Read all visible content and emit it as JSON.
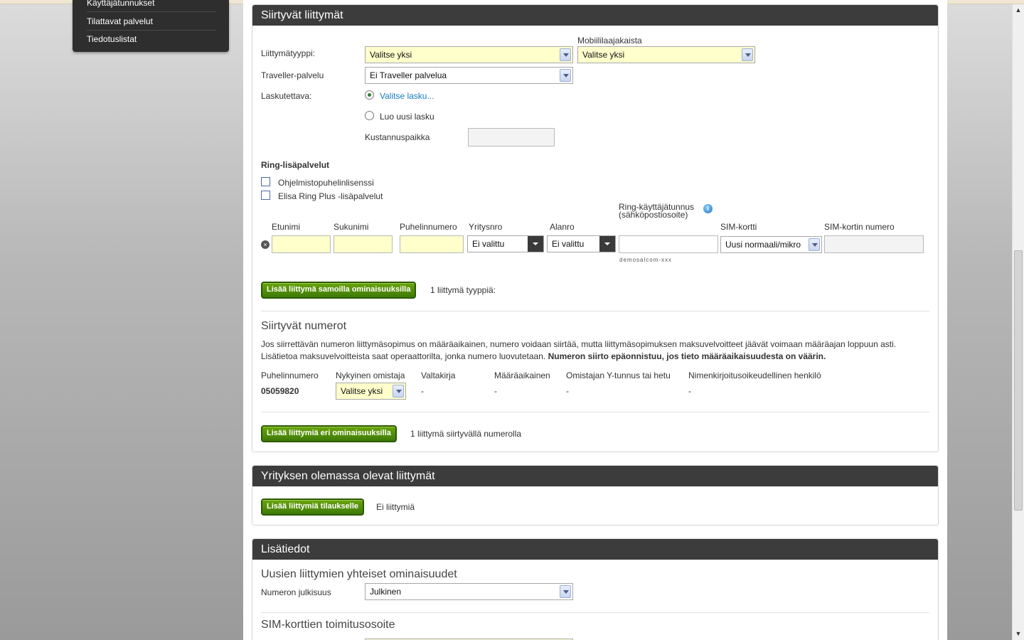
{
  "leftnav": {
    "items": [
      "Käyttäjätunnukset",
      "Tilattavat palvelut",
      "Tiedotuslistat"
    ]
  },
  "siirtyvat": {
    "title": "Siirtyvät liittymät",
    "liittymatyyppi_label": "Liittymätyyppi:",
    "liittymatyyppi_value": "Valitse yksi",
    "mobiililaajakaista_label": "Mobiililaajakaista",
    "mobiililaajakaista_value": "Valitse yksi",
    "traveller_label": "Traveller-palvelu",
    "traveller_value": "Ei Traveller palvelua",
    "laskutettava_label": "Laskutettava:",
    "valitse_lasku": "Valitse lasku...",
    "luo_uusi_lasku": "Luo uusi lasku",
    "kustannuspaikka_label": "Kustannuspaikka",
    "ring_title": "Ring-lisäpalvelut",
    "ring_option1": "Ohjelmistopuhelinlisenssi",
    "ring_option2": "Elisa Ring Plus -lisäpalvelut",
    "columns": {
      "etunimi": "Etunimi",
      "sukunimi": "Sukunimi",
      "puhelinnumero": "Puhelinnumero",
      "yritysnro": "Yritysnro",
      "alanro": "Alanro",
      "ring_kayttajatunnus": "Ring-käyttäjätunnus",
      "ring_sub": "(sähköpostiosoite)",
      "sim_kortti": "SIM-kortti",
      "sim_numero": "SIM-kortin numero"
    },
    "yritysnro_value": "Ei valittu",
    "alanro_value": "Ei valittu",
    "sim_value": "Uusi normaali/mikro",
    "ring_hint": "demosalcom-xxx",
    "add_same_button": "Lisää liittymä samoilla ominaisuuksilla",
    "add_same_count": "1 liittymä tyyppiä:",
    "numerot_title": "Siirtyvät numerot",
    "numerot_text1": "Jos siirrettävän numeron liittymäsopimus on määräaikainen, numero voidaan siirtää, mutta liittymäsopimuksen maksuvelvoitteet jäävät voimaan määräajan loppuun asti.",
    "numerot_text2": "Lisätietoa maksuvelvoitteista saat operaattorilta, jonka numero luovutetaan.",
    "numerot_text_bold": "Numeron siirto epäonnistuu, jos tieto määräaikaisuudesta on väärin.",
    "table_headers": [
      "Puhelinnumero",
      "Nykyinen omistaja",
      "Valtakirja",
      "Määräaikainen",
      "Omistajan Y-tunnus tai hetu",
      "Nimenkirjoitusoikeudellinen henkilö"
    ],
    "row": {
      "puhelinnumero": "05059820",
      "omistaja": "Valitse yksi",
      "valtakirja": "-",
      "maaraaikainen": "-",
      "ytunnus": "-",
      "henkilo": "-"
    },
    "add_diff_button": "Lisää liittymiä eri ominaisuuksilla",
    "add_diff_count": "1 liittymä siirtyvällä numerolla"
  },
  "olemassa": {
    "title": "Yrityksen olemassa olevat liittymät",
    "add_button": "Lisää liittymiä tilaukselle",
    "status": "Ei liittymiä"
  },
  "lisatiedot": {
    "title": "Lisätiedot",
    "yhteiset_title": "Uusien liittymien yhteiset ominaisuudet",
    "julkisuus_label": "Numeron julkisuus",
    "julkisuus_value": "Julkinen",
    "toimitus_title": "SIM-korttien toimitusosoite"
  }
}
